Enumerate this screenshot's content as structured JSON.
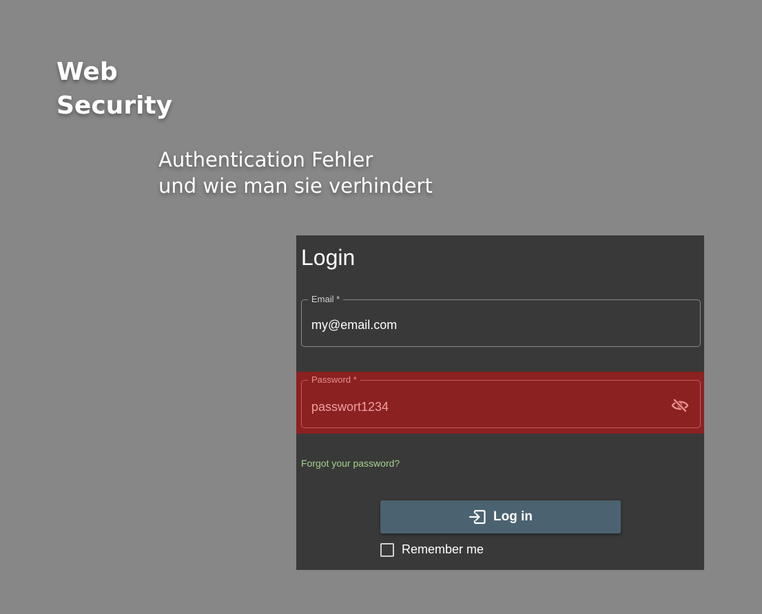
{
  "slide": {
    "title_line1": "Web",
    "title_line2": "Security",
    "subtitle_line1": "Authentication Fehler",
    "subtitle_line2": "und wie man sie verhindert"
  },
  "login": {
    "heading": "Login",
    "email": {
      "label": "Email *",
      "value": "my@email.com"
    },
    "password": {
      "label": "Password *",
      "value": "passwort1234",
      "toggle_icon": "eye-off-icon",
      "error_color": "#8b2121"
    },
    "forgot_link": "Forgot your password?",
    "login_button": {
      "label": "Log in",
      "icon": "login-icon",
      "color": "#4b6270"
    },
    "remember_me": {
      "label": "Remember me",
      "checked": false
    }
  }
}
